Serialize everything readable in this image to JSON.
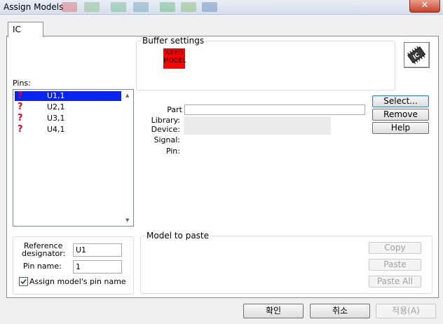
{
  "window": {
    "title": "Assign Models",
    "close_glyph": "✕"
  },
  "tabs": [
    {
      "label": "IC"
    }
  ],
  "buffer_settings": {
    "legend": "Buffer settings",
    "badge_line1": "NEED",
    "badge_line2": "MODEL"
  },
  "ic_icon": {
    "label": "IC"
  },
  "pins": {
    "label": "Pins:",
    "items": [
      {
        "mark": "?",
        "name": "U1,1",
        "selected": true
      },
      {
        "mark": "?",
        "name": "U2,1",
        "selected": false
      },
      {
        "mark": "?",
        "name": "U3,1",
        "selected": false
      },
      {
        "mark": "?",
        "name": "U4,1",
        "selected": false
      }
    ]
  },
  "details": {
    "part_label": "Part",
    "library_label": "Library:",
    "device_label": "Device:",
    "signal_label": "Signal:",
    "pin_label": "Pin:",
    "part_value": ""
  },
  "side_buttons": {
    "select": "Select...",
    "remove": "Remove",
    "help": "Help"
  },
  "reference": {
    "ref_label_line1": "Reference",
    "ref_label_line2": "designator:",
    "ref_value": "U1",
    "pin_name_label": "Pin name:",
    "pin_name_value": "1",
    "assign_checkbox_label": "Assign model's pin name",
    "assign_checked": true
  },
  "model_to_paste": {
    "legend": "Model to paste",
    "copy": "Copy",
    "paste": "Paste",
    "paste_all": "Paste All"
  },
  "footer": {
    "ok": "확인",
    "cancel": "취소",
    "apply": "적용(A)"
  },
  "colors": {
    "selection": "#0a24f0",
    "need_model": "#ff0000",
    "question_mark": "#d0102a"
  }
}
